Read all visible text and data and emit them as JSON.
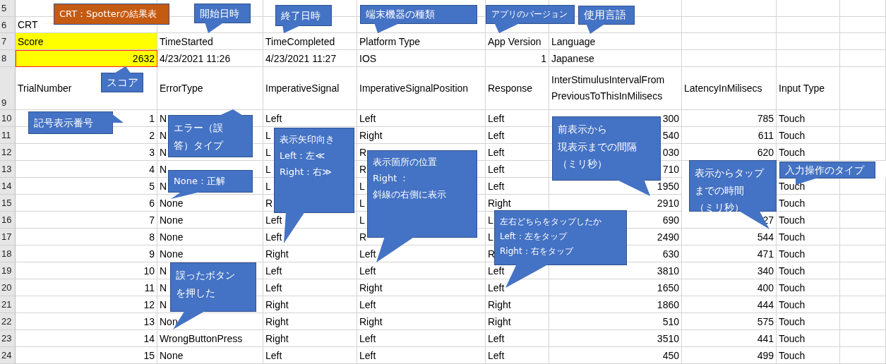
{
  "row_numbers": [
    "5",
    "6",
    "7",
    "8",
    "9",
    "10",
    "11",
    "12",
    "13",
    "14",
    "15",
    "16",
    "17",
    "18",
    "19",
    "20",
    "21",
    "22",
    "23",
    "24"
  ],
  "title_cell": "CRT",
  "summary": [
    {
      "header": "Score",
      "value": "2632",
      "highlighted": true
    },
    {
      "header": "TimeStarted",
      "value": "4/23/2021 11:26",
      "highlighted": false
    },
    {
      "header": "TimeCompleted",
      "value": "4/23/2021 11:27",
      "highlighted": false
    },
    {
      "header": "Platform Type",
      "value": "IOS",
      "highlighted": false
    },
    {
      "header": "App Version",
      "value": "1",
      "highlighted": false
    },
    {
      "header": "Language",
      "value": "Japanese",
      "highlighted": false
    }
  ],
  "table": {
    "columns": [
      "TrialNumber",
      "ErrorType",
      "ImperativeSignal",
      "ImperativeSignalPosition",
      "Response",
      "InterStimulusIntervalFrom PreviousToThisInMilisecs",
      "LatencyInMilisecs",
      "Input Type"
    ],
    "rows": [
      {
        "trial": "1",
        "error_type": "N",
        "signal": "Left",
        "position": "Left",
        "response": "Left",
        "interval": "300",
        "latency": "785",
        "input_type": "Touch"
      },
      {
        "trial": "2",
        "error_type": "N",
        "signal": "L",
        "position": "Right",
        "response": "Left",
        "interval": "540",
        "latency": "611",
        "input_type": "Touch"
      },
      {
        "trial": "3",
        "error_type": "N",
        "signal": "L",
        "position": "R",
        "response": "Left",
        "interval": "030",
        "latency": "620",
        "input_type": "Touch"
      },
      {
        "trial": "4",
        "error_type": "N",
        "signal": "L",
        "position": "R",
        "response": "Left",
        "interval": "710"
      },
      {
        "trial": "5",
        "error_type": "N",
        "signal": "L",
        "position": "L",
        "response": "Left",
        "interval": "1950",
        "input_type": "Touch"
      },
      {
        "trial": "6",
        "error_type": "None",
        "signal": "R",
        "position": "L",
        "response": "Right",
        "interval": "2910",
        "input_type": "Touch"
      },
      {
        "trial": "7",
        "error_type": "None",
        "signal": "Left",
        "position": "L",
        "response": "L",
        "interval": "690",
        "latency": "27",
        "input_type": "Touch"
      },
      {
        "trial": "8",
        "error_type": "None",
        "signal": "Left",
        "position": "R",
        "response": "L",
        "interval": "2490",
        "latency": "544",
        "input_type": "Touch"
      },
      {
        "trial": "9",
        "error_type": "None",
        "signal": "Right",
        "position": "Left",
        "response": "R",
        "interval": "630",
        "latency": "471",
        "input_type": "Touch"
      },
      {
        "trial": "10",
        "error_type": "N",
        "signal": "Left",
        "position": "Left",
        "response": "Left",
        "interval": "3810",
        "latency": "340",
        "input_type": "Touch"
      },
      {
        "trial": "11",
        "error_type": "N",
        "signal": "Left",
        "position": "Right",
        "response": "Left",
        "interval": "1650",
        "latency": "400",
        "input_type": "Touch"
      },
      {
        "trial": "12",
        "error_type": "N",
        "signal": "Right",
        "position": "Left",
        "response": "Right",
        "interval": "1860",
        "latency": "444",
        "input_type": "Touch"
      },
      {
        "trial": "13",
        "error_type": "Non",
        "signal": "Right",
        "position": "Right",
        "response": "Right",
        "interval": "510",
        "latency": "575",
        "input_type": "Touch"
      },
      {
        "trial": "14",
        "error_type": "WrongButtonPress",
        "signal": "Right",
        "position": "Left",
        "response": "Left",
        "interval": "3510",
        "latency": "441",
        "input_type": "Touch"
      },
      {
        "trial": "15",
        "error_type": "None",
        "signal": "Left",
        "position": "Left",
        "response": "Left",
        "interval": "450",
        "latency": "499",
        "input_type": "Touch"
      }
    ]
  },
  "callouts": [
    {
      "lines": [
        "CRT：Spotterの結果表"
      ],
      "color": "#c55a11"
    },
    {
      "lines": [
        "開始日時"
      ],
      "color": "#4472c4"
    },
    {
      "lines": [
        "終了日時"
      ],
      "color": "#4472c4"
    },
    {
      "lines": [
        "端末機器の種類"
      ],
      "color": "#4472c4"
    },
    {
      "lines": [
        "アプリのバージョン"
      ],
      "color": "#4472c4"
    },
    {
      "lines": [
        "使用言語"
      ],
      "color": "#4472c4"
    },
    {
      "lines": [
        "スコア"
      ],
      "color": "#4472c4"
    },
    {
      "lines": [
        "記号表示番号"
      ],
      "color": "#4472c4"
    },
    {
      "lines": [
        "エラー（誤",
        "答）タイプ"
      ],
      "color": "#4472c4"
    },
    {
      "lines": [
        "None：正解"
      ],
      "color": "#4472c4"
    },
    {
      "lines": [
        "表示矢印向き",
        "Left：左≪",
        "Right：右≫"
      ],
      "color": "#4472c4"
    },
    {
      "lines": [
        "表示箇所の位置",
        "Right ：",
        "斜線の右側に表示"
      ],
      "color": "#4472c4"
    },
    {
      "lines": [
        "誤ったボタン",
        "を押した"
      ],
      "color": "#4472c4"
    },
    {
      "lines": [
        "左右どちらをタップしたか",
        "Left：左をタップ",
        "Right：右をタップ"
      ],
      "color": "#4472c4"
    },
    {
      "lines": [
        "前表示から",
        "現表示までの間隔",
        "（ミリ秒）"
      ],
      "color": "#4472c4"
    },
    {
      "lines": [
        "表示からタップ",
        "までの時間",
        "（ミリ秒）"
      ],
      "color": "#4472c4"
    },
    {
      "lines": [
        "入力操作のタイプ"
      ],
      "color": "#4472c4"
    }
  ]
}
